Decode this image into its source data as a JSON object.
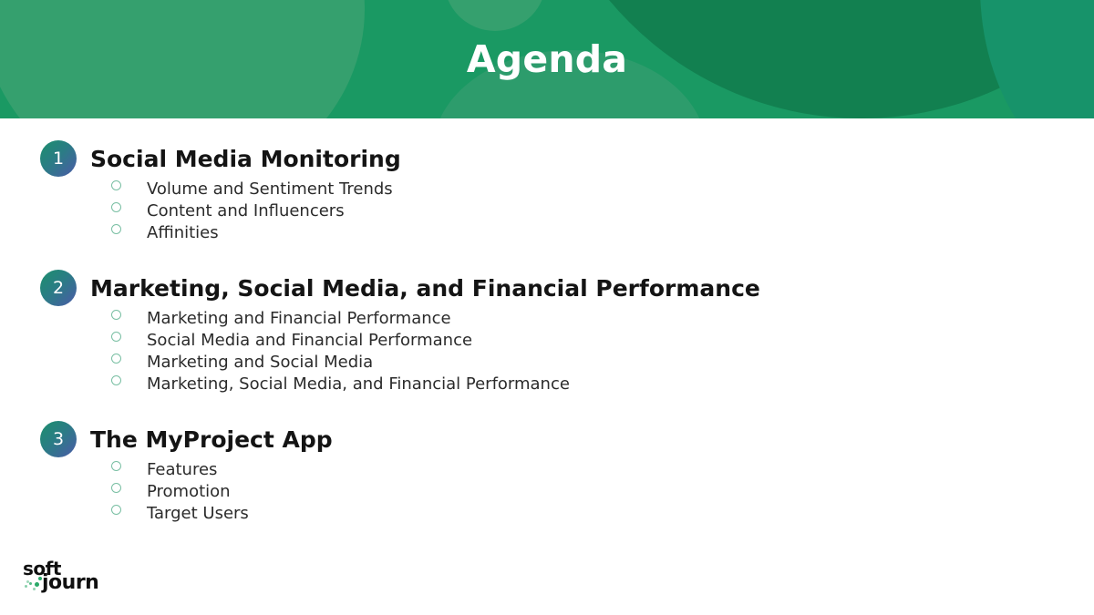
{
  "slide": {
    "title": "Agenda",
    "brand_color": "#1a9963",
    "accent_color": "#128050",
    "heading_color": "#141414",
    "bullet_marker_color": "#79bfa3",
    "badge_gradient_from": "#1c8f6d",
    "badge_gradient_to": "#4b5aa8"
  },
  "sections": [
    {
      "number": "1",
      "title": "Social Media Monitoring",
      "bullets": [
        "Volume and Sentiment Trends",
        "Content and Influencers",
        "Affinities"
      ]
    },
    {
      "number": "2",
      "title": "Marketing, Social Media, and Financial Performance",
      "bullets": [
        "Marketing and Financial Performance",
        "Social Media and Financial Performance",
        "Marketing and Social Media",
        "Marketing, Social Media, and Financial Performance"
      ]
    },
    {
      "number": "3",
      "title": "The MyProject App",
      "bullets": [
        "Features",
        "Promotion",
        "Target Users"
      ]
    }
  ],
  "logo": {
    "line1": "soft",
    "line2": "journ",
    "dot_color": "#2aa968"
  }
}
